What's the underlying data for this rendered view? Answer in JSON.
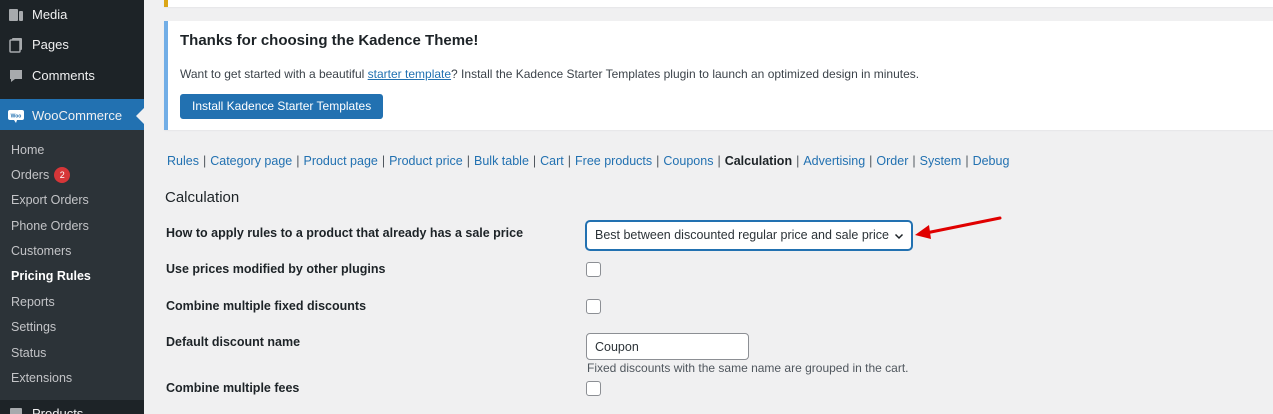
{
  "sidebar": {
    "top_items": [
      {
        "label": "Media",
        "icon": "media-icon"
      },
      {
        "label": "Pages",
        "icon": "pages-icon"
      },
      {
        "label": "Comments",
        "icon": "comments-icon"
      }
    ],
    "woocommerce": {
      "label": "WooCommerce",
      "icon": "woocommerce-icon"
    },
    "submenu": [
      {
        "label": "Home"
      },
      {
        "label": "Orders",
        "badge": "2"
      },
      {
        "label": "Export Orders"
      },
      {
        "label": "Phone Orders"
      },
      {
        "label": "Customers"
      },
      {
        "label": "Pricing Rules",
        "current": true
      },
      {
        "label": "Reports"
      },
      {
        "label": "Settings"
      },
      {
        "label": "Status"
      },
      {
        "label": "Extensions"
      }
    ],
    "bottom_item": {
      "label": "Products",
      "icon": "products-icon"
    }
  },
  "notice": {
    "title": "Thanks for choosing the Kadence Theme!",
    "text_before": "Want to get started with a beautiful ",
    "link": "starter template",
    "text_after": "? Install the Kadence Starter Templates plugin to launch an optimized design in minutes.",
    "button": "Install Kadence Starter Templates"
  },
  "tabs": [
    "Rules",
    "Category page",
    "Product page",
    "Product price",
    "Bulk table",
    "Cart",
    "Free products",
    "Coupons",
    "Calculation",
    "Advertising",
    "Order",
    "System",
    "Debug"
  ],
  "current_tab": "Calculation",
  "section_title": "Calculation",
  "settings": {
    "apply_rules_label": "How to apply rules to a product that already has a sale price",
    "apply_rules_value": "Best between discounted regular price and sale price",
    "modified_prices_label": "Use prices modified by other plugins",
    "combine_fixed_label": "Combine multiple fixed discounts",
    "default_name_label": "Default discount name",
    "default_name_value": "Coupon",
    "default_name_desc": "Fixed discounts with the same name are grouped in the cart.",
    "combine_fees_label": "Combine multiple fees"
  },
  "colors": {
    "accent": "#2271b1",
    "sidebar": "#1d2327",
    "annotation_arrow": "#e00000"
  }
}
